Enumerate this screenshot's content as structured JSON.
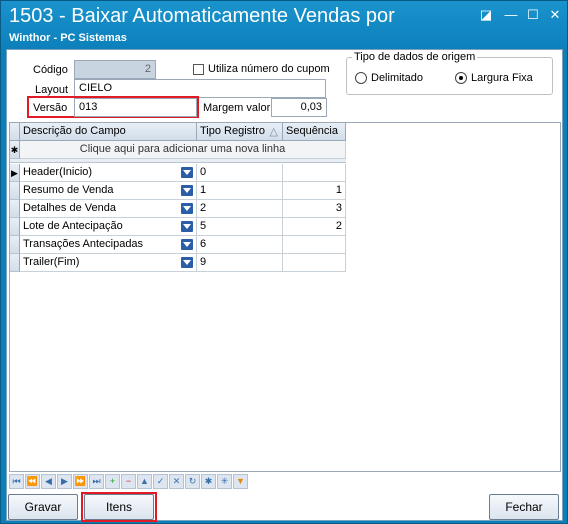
{
  "window": {
    "title": "1503 - Baixar Automaticamente Vendas por",
    "subtitle": "Winthor - PC Sistemas"
  },
  "form": {
    "codigo_label": "Código",
    "codigo_value": "2",
    "layout_label": "Layout",
    "layout_value": "CIELO",
    "versao_label": "Versão",
    "versao_value": "013",
    "cupom_label": "Utiliza número do cupom",
    "margem_label": "Margem valor",
    "margem_value": "0,03"
  },
  "origem": {
    "title": "Tipo de dados de origem",
    "options": [
      "Delimitado",
      "Largura Fixa"
    ],
    "selected": "Largura Fixa"
  },
  "grid": {
    "columns": [
      "Descrição do Campo",
      "Tipo Registro",
      "Sequência"
    ],
    "new_row_text": "Clique aqui para adicionar uma nova linha",
    "rows": [
      {
        "descricao": "Header(Inicio)",
        "tipo": "0",
        "seq": ""
      },
      {
        "descricao": "Resumo de Venda",
        "tipo": "1",
        "seq": "1"
      },
      {
        "descricao": "Detalhes de Venda",
        "tipo": "2",
        "seq": "3"
      },
      {
        "descricao": "Lote de Antecipação",
        "tipo": "5",
        "seq": "2"
      },
      {
        "descricao": "Transações Antecipadas",
        "tipo": "6",
        "seq": ""
      },
      {
        "descricao": "Trailer(Fim)",
        "tipo": "9",
        "seq": ""
      }
    ]
  },
  "navigator": {
    "buttons": [
      "first",
      "prev-page",
      "prev",
      "next",
      "next-page",
      "last",
      "insert",
      "delete",
      "edit",
      "post",
      "cancel",
      "refresh",
      "bookmark",
      "goto-bookmark",
      "filter"
    ],
    "glyphs": [
      "⏮",
      "⏪",
      "◀",
      "▶",
      "⏩",
      "⏭",
      "+",
      "−",
      "▲",
      "✓",
      "✕",
      "↻",
      "✱",
      "✳",
      "▼"
    ]
  },
  "buttons": {
    "gravar": "Gravar",
    "itens": "Itens",
    "fechar": "Fechar"
  },
  "colors": {
    "title_bar": "#0d80bb",
    "highlight": "#e01b24",
    "dropdown": "#2a5fa8"
  }
}
